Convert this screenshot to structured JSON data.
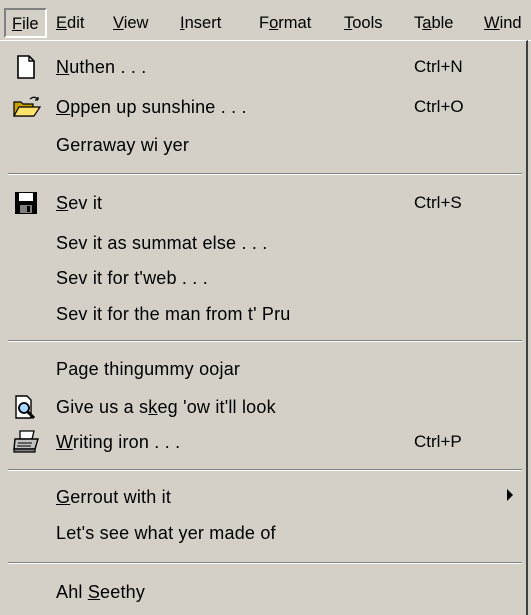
{
  "menubar": {
    "items": [
      {
        "label": "File",
        "mnemonic": "F"
      },
      {
        "label": "Edit",
        "mnemonic": "E"
      },
      {
        "label": "View",
        "mnemonic": "V"
      },
      {
        "label": "Insert",
        "mnemonic": "I"
      },
      {
        "label": "Format",
        "mnemonic": "o"
      },
      {
        "label": "Tools",
        "mnemonic": "T"
      },
      {
        "label": "Table",
        "mnemonic": "a"
      },
      {
        "label": "Wind",
        "mnemonic": "W"
      }
    ],
    "active": "File"
  },
  "file_menu": {
    "items": [
      {
        "pre": "",
        "u": "N",
        "post": "uthen . . .",
        "shortcut": "Ctrl+N",
        "icon": "new-document-icon"
      },
      {
        "pre": "",
        "u": "O",
        "post": "ppen up sunshine . . .",
        "shortcut": "Ctrl+O",
        "icon": "open-folder-icon"
      },
      {
        "pre": "Gerraway wi yer",
        "u": "",
        "post": "",
        "shortcut": "",
        "icon": ""
      },
      {
        "pre": "",
        "u": "S",
        "post": "ev it",
        "shortcut": "Ctrl+S",
        "icon": "floppy-disk-icon"
      },
      {
        "pre": "Sev it as summat else . . .",
        "u": "",
        "post": "",
        "shortcut": "",
        "icon": ""
      },
      {
        "pre": "Sev it for t'web . . .",
        "u": "",
        "post": "",
        "shortcut": "",
        "icon": ""
      },
      {
        "pre": "Sev it for the man from t' Pru",
        "u": "",
        "post": "",
        "shortcut": "",
        "icon": ""
      },
      {
        "pre": "Page thingummy oojar",
        "u": "",
        "post": "",
        "shortcut": "",
        "icon": ""
      },
      {
        "pre": "Give us a s",
        "u": "k",
        "post": "eg 'ow it'll look",
        "shortcut": "",
        "icon": "print-preview-icon"
      },
      {
        "pre": "",
        "u": "W",
        "post": "riting iron . . .",
        "shortcut": "Ctrl+P",
        "icon": "printer-icon"
      },
      {
        "pre": "",
        "u": "G",
        "post": "errout with it",
        "shortcut": "",
        "icon": "",
        "submenu": true
      },
      {
        "pre": "Let's see what yer made of",
        "u": "",
        "post": "",
        "shortcut": "",
        "icon": ""
      },
      {
        "pre": "Ahl ",
        "u": "S",
        "post": "eethy",
        "shortcut": "",
        "icon": ""
      }
    ]
  }
}
